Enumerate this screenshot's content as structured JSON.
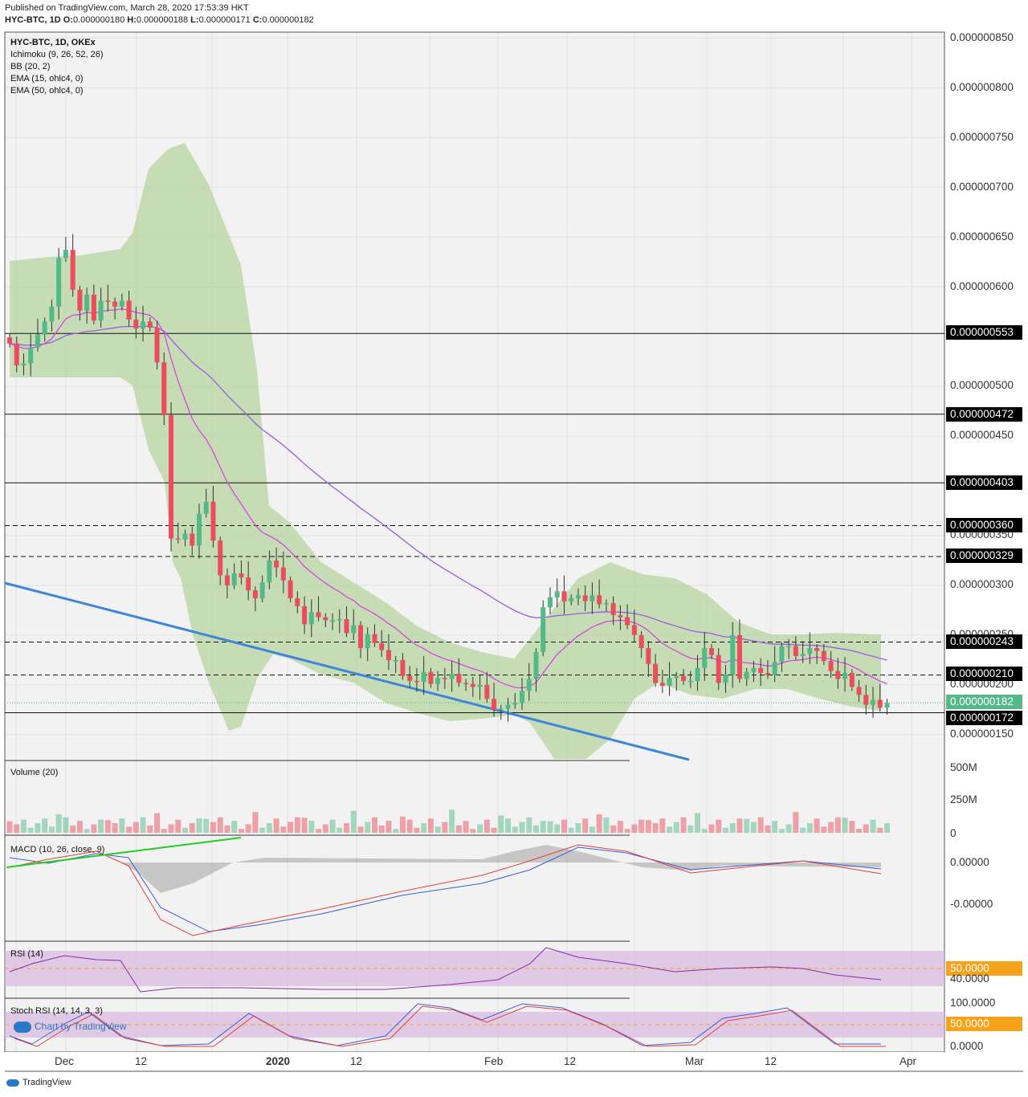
{
  "header": {
    "published": "Published on TradingView.com, March 28, 2020 17:53:39 HKT",
    "symbol": "HYC-BTC, 1D",
    "ohlc_o_label": "O:",
    "ohlc_o": "0.000000180",
    "ohlc_h_label": "H:",
    "ohlc_h": "0.000000188",
    "ohlc_l_label": "L:",
    "ohlc_l": "0.000000171",
    "ohlc_c_label": "C:",
    "ohlc_c": "0.000000182"
  },
  "legend": {
    "title": "HYC-BTC, 1D, OKEx",
    "ichimoku": "Ichimoku (9, 26, 52, 26)",
    "bb": "BB (20, 2)",
    "ema15": "EMA (15, ohlc4, 0)",
    "ema50": "EMA (50, ohlc4, 0)"
  },
  "panes": {
    "volume_title": "Volume (20)",
    "macd_title": "MACD (10, 26, close, 9)",
    "rsi_title": "RSI (14)",
    "stoch_title": "Stoch RSI (14, 14, 3, 3)"
  },
  "colors": {
    "up": "#53b987",
    "down": "#eb4d5c",
    "bb_fill": "#b5d4a0",
    "ema15": "#d946e0",
    "ema50": "#9a5ce0",
    "trend": "#3f86d9",
    "green_line": "#22cc22",
    "rsi_band": "#d9b8e0"
  },
  "chart_data": {
    "type": "candlestick",
    "price_axis": {
      "labels": [
        "0.000000850",
        "0.000000800",
        "0.000000750",
        "0.000000700",
        "0.000000650",
        "0.000000600",
        "0.000000500",
        "0.000000450",
        "0.000000350",
        "0.000000300",
        "0.000000250",
        "0.000000200",
        "0.000000150"
      ],
      "values": [
        850,
        800,
        750,
        700,
        650,
        600,
        500,
        450,
        350,
        300,
        250,
        200,
        150
      ],
      "unit_scale": "1e-9 BTC"
    },
    "price_ylim": [
      110,
      860
    ],
    "levels": [
      {
        "label": "0.000000553",
        "value": 553,
        "style": "solid"
      },
      {
        "label": "0.000000472",
        "value": 472,
        "style": "solid"
      },
      {
        "label": "0.000000403",
        "value": 403,
        "style": "solid"
      },
      {
        "label": "0.000000360",
        "value": 360,
        "style": "dashed"
      },
      {
        "label": "0.000000329",
        "value": 329,
        "style": "dashed"
      },
      {
        "label": "0.000000243",
        "value": 243,
        "style": "dashed"
      },
      {
        "label": "0.000000210",
        "value": 210,
        "style": "dashed"
      },
      {
        "label": "0.000000172",
        "value": 172,
        "style": "solid"
      }
    ],
    "last_price": {
      "label": "0.000000182",
      "value": 182
    },
    "x_axis": {
      "labels": [
        "Dec",
        "12",
        "2020",
        "12",
        "Feb",
        "12",
        "Mar",
        "12",
        "Apr"
      ],
      "days": [
        14,
        25,
        44,
        55,
        78,
        90,
        107,
        119,
        140
      ]
    },
    "candles_close": [
      543,
      521,
      523,
      539,
      552,
      565,
      580,
      629,
      637,
      597,
      576,
      592,
      566,
      586,
      585,
      580,
      586,
      567,
      558,
      565,
      559,
      524,
      471,
      347,
      346,
      352,
      340,
      372,
      384,
      345,
      310,
      300,
      312,
      308,
      295,
      287,
      303,
      325,
      318,
      305,
      287,
      279,
      261,
      273,
      268,
      265,
      265,
      266,
      252,
      260,
      237,
      251,
      242,
      235,
      225,
      225,
      209,
      204,
      203,
      213,
      201,
      207,
      206,
      211,
      202,
      201,
      198,
      200,
      186,
      175,
      176,
      180,
      182,
      194,
      206,
      233,
      278,
      288,
      294,
      284,
      287,
      290,
      284,
      290,
      281,
      282,
      270,
      268,
      260,
      250,
      237,
      221,
      202,
      199,
      207,
      209,
      204,
      204,
      217,
      237,
      230,
      202,
      210,
      250,
      206,
      213,
      217,
      212,
      210,
      223,
      239,
      239,
      229,
      231,
      237,
      234,
      224,
      214,
      206,
      212,
      198,
      190,
      180,
      185,
      177,
      182
    ],
    "volume_axis": {
      "labels": [
        "500M",
        "250M",
        "0"
      ],
      "values": [
        500,
        250,
        0
      ]
    },
    "macd_axis": {
      "labels": [
        "0.00000",
        "-0.00000"
      ]
    },
    "rsi_axis": {
      "labels": [
        "50.0000",
        "40.0000"
      ],
      "values": [
        50,
        40
      ]
    },
    "stoch_axis": {
      "labels": [
        "100.0000",
        "50.0000",
        "0.0000"
      ],
      "values": [
        100,
        50,
        0
      ]
    }
  },
  "watermark": "Chart by TradingView",
  "footer": "TradingView"
}
